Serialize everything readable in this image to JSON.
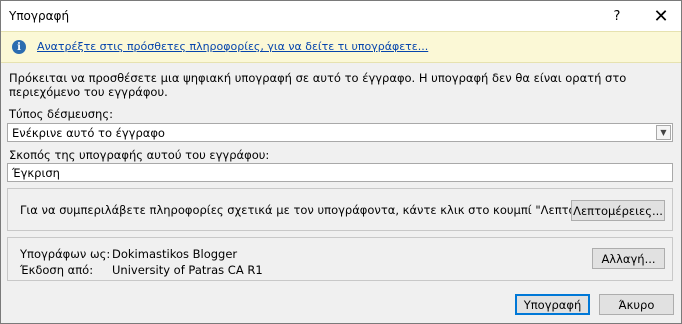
{
  "window": {
    "title": "Υπογραφή",
    "help_glyph": "?",
    "close_glyph": "✕"
  },
  "infobar": {
    "icon": "info-icon",
    "icon_glyph": "i",
    "link_text": "Ανατρέξτε στις πρόσθετες πληροφορίες, για να δείτε τι υπογράφετε..."
  },
  "description": "Πρόκειται να προσθέσετε μια ψηφιακή υπογραφή σε αυτό το έγγραφο. Η υπογραφή δεν θα είναι ορατή στο περιεχόμενο του εγγράφου.",
  "commitment": {
    "label": "Τύπος δέσμευσης:",
    "selected": "Ενέκρινε αυτό το έγγραφο"
  },
  "purpose": {
    "label": "Σκοπός της υπογραφής αυτού του εγγράφου:",
    "value": "Έγκριση"
  },
  "details_group": {
    "text": "Για να συμπεριλάβετε πληροφορίες σχετικά με τον υπογράφοντα, κάντε κλικ στο κουμπί \"Λεπτομέρειες\".",
    "button_label": "Λεπτομέρειες..."
  },
  "signer_group": {
    "signing_as_label": "Υπογράφων ως:",
    "signing_as_value": "Dokimastikos Blogger",
    "issued_by_label": "Έκδοση από:",
    "issued_by_value": "University of Patras CA R1",
    "change_button_label": "Αλλαγή..."
  },
  "footer": {
    "sign_label": "Υπογραφή",
    "cancel_label": "Άκυρο"
  },
  "colors": {
    "infobar_bg": "#fbf8d6",
    "link": "#0645ad",
    "default_button_border": "#0078d7"
  }
}
